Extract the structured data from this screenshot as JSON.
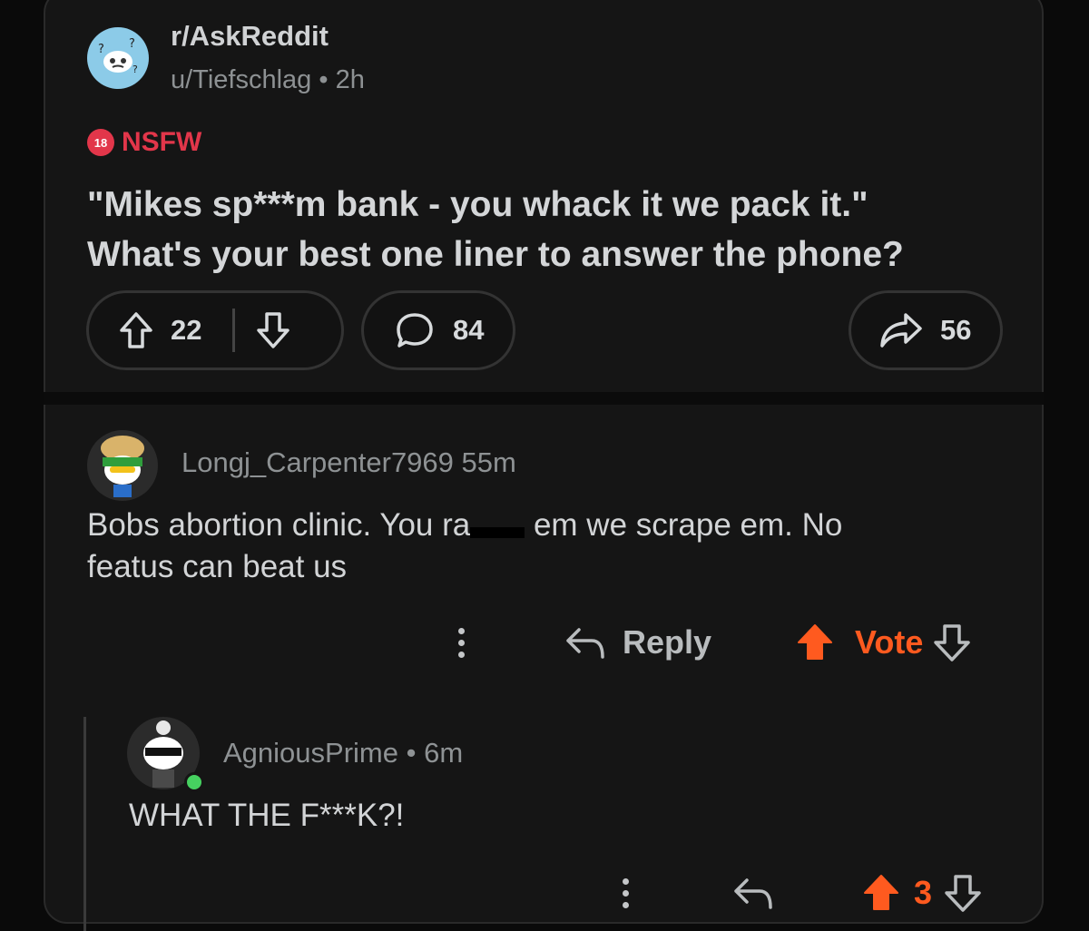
{
  "post": {
    "subreddit": "r/AskReddit",
    "author": "u/Tiefschlag",
    "separator": "•",
    "age": "2h",
    "nsfw_badge": "18",
    "nsfw_label": "NSFW",
    "title_line1": "\"Mikes sp***m bank - you whack it we pack it.\"",
    "title_line2": "What's your best one liner to answer the phone?",
    "upvotes": "22",
    "comments": "84",
    "shares": "56"
  },
  "comments": [
    {
      "user": "Longj_Carpenter7969",
      "time": "55m",
      "body_part1": "Bobs abortion clinic.  You ra",
      "body_part2": " em we scrape em.  No",
      "body_line2": "featus can beat us",
      "reply_label": "Reply",
      "vote_label": "Vote"
    },
    {
      "user": "AgniousPrime",
      "separator": "•",
      "time": "6m",
      "body": "WHAT THE F***K?!",
      "score": "3"
    }
  ],
  "colors": {
    "background": "#151515",
    "accent_orange": "#ff5a1f",
    "nsfw_red": "#e2364a",
    "text": "#d7dadc",
    "muted": "#8e9294"
  }
}
